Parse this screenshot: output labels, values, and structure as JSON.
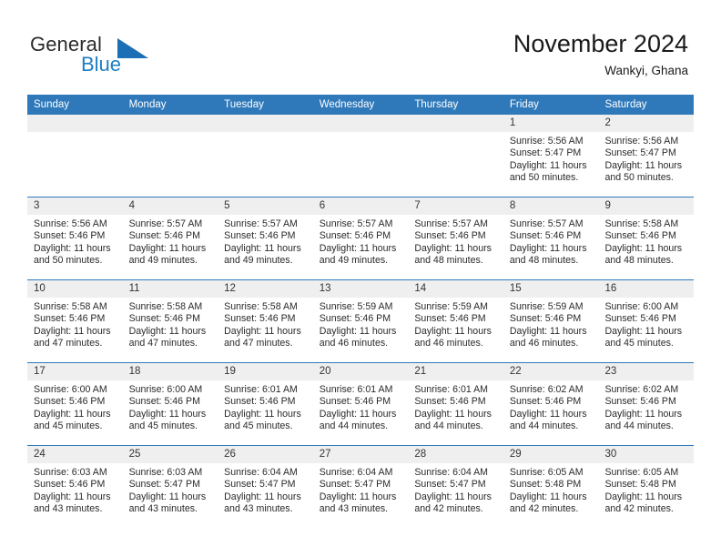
{
  "brand": {
    "word1": "General",
    "word2": "Blue",
    "logo_icon": "triangle-logo-icon"
  },
  "header": {
    "title": "November 2024",
    "location": "Wankyi, Ghana"
  },
  "calendar": {
    "weekday_headers": [
      "Sunday",
      "Monday",
      "Tuesday",
      "Wednesday",
      "Thursday",
      "Friday",
      "Saturday"
    ],
    "colors": {
      "header_bar": "#2f79ba",
      "day_number_strip": "#efefef",
      "row_divider": "#2f79ba",
      "brand_blue": "#1f7ec4"
    },
    "weeks": [
      [
        {
          "day": "",
          "empty": true
        },
        {
          "day": "",
          "empty": true
        },
        {
          "day": "",
          "empty": true
        },
        {
          "day": "",
          "empty": true
        },
        {
          "day": "",
          "empty": true
        },
        {
          "day": "1",
          "sunrise": "Sunrise: 5:56 AM",
          "sunset": "Sunset: 5:47 PM",
          "daylight1": "Daylight: 11 hours",
          "daylight2": "and 50 minutes."
        },
        {
          "day": "2",
          "sunrise": "Sunrise: 5:56 AM",
          "sunset": "Sunset: 5:47 PM",
          "daylight1": "Daylight: 11 hours",
          "daylight2": "and 50 minutes."
        }
      ],
      [
        {
          "day": "3",
          "sunrise": "Sunrise: 5:56 AM",
          "sunset": "Sunset: 5:46 PM",
          "daylight1": "Daylight: 11 hours",
          "daylight2": "and 50 minutes."
        },
        {
          "day": "4",
          "sunrise": "Sunrise: 5:57 AM",
          "sunset": "Sunset: 5:46 PM",
          "daylight1": "Daylight: 11 hours",
          "daylight2": "and 49 minutes."
        },
        {
          "day": "5",
          "sunrise": "Sunrise: 5:57 AM",
          "sunset": "Sunset: 5:46 PM",
          "daylight1": "Daylight: 11 hours",
          "daylight2": "and 49 minutes."
        },
        {
          "day": "6",
          "sunrise": "Sunrise: 5:57 AM",
          "sunset": "Sunset: 5:46 PM",
          "daylight1": "Daylight: 11 hours",
          "daylight2": "and 49 minutes."
        },
        {
          "day": "7",
          "sunrise": "Sunrise: 5:57 AM",
          "sunset": "Sunset: 5:46 PM",
          "daylight1": "Daylight: 11 hours",
          "daylight2": "and 48 minutes."
        },
        {
          "day": "8",
          "sunrise": "Sunrise: 5:57 AM",
          "sunset": "Sunset: 5:46 PM",
          "daylight1": "Daylight: 11 hours",
          "daylight2": "and 48 minutes."
        },
        {
          "day": "9",
          "sunrise": "Sunrise: 5:58 AM",
          "sunset": "Sunset: 5:46 PM",
          "daylight1": "Daylight: 11 hours",
          "daylight2": "and 48 minutes."
        }
      ],
      [
        {
          "day": "10",
          "sunrise": "Sunrise: 5:58 AM",
          "sunset": "Sunset: 5:46 PM",
          "daylight1": "Daylight: 11 hours",
          "daylight2": "and 47 minutes."
        },
        {
          "day": "11",
          "sunrise": "Sunrise: 5:58 AM",
          "sunset": "Sunset: 5:46 PM",
          "daylight1": "Daylight: 11 hours",
          "daylight2": "and 47 minutes."
        },
        {
          "day": "12",
          "sunrise": "Sunrise: 5:58 AM",
          "sunset": "Sunset: 5:46 PM",
          "daylight1": "Daylight: 11 hours",
          "daylight2": "and 47 minutes."
        },
        {
          "day": "13",
          "sunrise": "Sunrise: 5:59 AM",
          "sunset": "Sunset: 5:46 PM",
          "daylight1": "Daylight: 11 hours",
          "daylight2": "and 46 minutes."
        },
        {
          "day": "14",
          "sunrise": "Sunrise: 5:59 AM",
          "sunset": "Sunset: 5:46 PM",
          "daylight1": "Daylight: 11 hours",
          "daylight2": "and 46 minutes."
        },
        {
          "day": "15",
          "sunrise": "Sunrise: 5:59 AM",
          "sunset": "Sunset: 5:46 PM",
          "daylight1": "Daylight: 11 hours",
          "daylight2": "and 46 minutes."
        },
        {
          "day": "16",
          "sunrise": "Sunrise: 6:00 AM",
          "sunset": "Sunset: 5:46 PM",
          "daylight1": "Daylight: 11 hours",
          "daylight2": "and 45 minutes."
        }
      ],
      [
        {
          "day": "17",
          "sunrise": "Sunrise: 6:00 AM",
          "sunset": "Sunset: 5:46 PM",
          "daylight1": "Daylight: 11 hours",
          "daylight2": "and 45 minutes."
        },
        {
          "day": "18",
          "sunrise": "Sunrise: 6:00 AM",
          "sunset": "Sunset: 5:46 PM",
          "daylight1": "Daylight: 11 hours",
          "daylight2": "and 45 minutes."
        },
        {
          "day": "19",
          "sunrise": "Sunrise: 6:01 AM",
          "sunset": "Sunset: 5:46 PM",
          "daylight1": "Daylight: 11 hours",
          "daylight2": "and 45 minutes."
        },
        {
          "day": "20",
          "sunrise": "Sunrise: 6:01 AM",
          "sunset": "Sunset: 5:46 PM",
          "daylight1": "Daylight: 11 hours",
          "daylight2": "and 44 minutes."
        },
        {
          "day": "21",
          "sunrise": "Sunrise: 6:01 AM",
          "sunset": "Sunset: 5:46 PM",
          "daylight1": "Daylight: 11 hours",
          "daylight2": "and 44 minutes."
        },
        {
          "day": "22",
          "sunrise": "Sunrise: 6:02 AM",
          "sunset": "Sunset: 5:46 PM",
          "daylight1": "Daylight: 11 hours",
          "daylight2": "and 44 minutes."
        },
        {
          "day": "23",
          "sunrise": "Sunrise: 6:02 AM",
          "sunset": "Sunset: 5:46 PM",
          "daylight1": "Daylight: 11 hours",
          "daylight2": "and 44 minutes."
        }
      ],
      [
        {
          "day": "24",
          "sunrise": "Sunrise: 6:03 AM",
          "sunset": "Sunset: 5:46 PM",
          "daylight1": "Daylight: 11 hours",
          "daylight2": "and 43 minutes."
        },
        {
          "day": "25",
          "sunrise": "Sunrise: 6:03 AM",
          "sunset": "Sunset: 5:47 PM",
          "daylight1": "Daylight: 11 hours",
          "daylight2": "and 43 minutes."
        },
        {
          "day": "26",
          "sunrise": "Sunrise: 6:04 AM",
          "sunset": "Sunset: 5:47 PM",
          "daylight1": "Daylight: 11 hours",
          "daylight2": "and 43 minutes."
        },
        {
          "day": "27",
          "sunrise": "Sunrise: 6:04 AM",
          "sunset": "Sunset: 5:47 PM",
          "daylight1": "Daylight: 11 hours",
          "daylight2": "and 43 minutes."
        },
        {
          "day": "28",
          "sunrise": "Sunrise: 6:04 AM",
          "sunset": "Sunset: 5:47 PM",
          "daylight1": "Daylight: 11 hours",
          "daylight2": "and 42 minutes."
        },
        {
          "day": "29",
          "sunrise": "Sunrise: 6:05 AM",
          "sunset": "Sunset: 5:48 PM",
          "daylight1": "Daylight: 11 hours",
          "daylight2": "and 42 minutes."
        },
        {
          "day": "30",
          "sunrise": "Sunrise: 6:05 AM",
          "sunset": "Sunset: 5:48 PM",
          "daylight1": "Daylight: 11 hours",
          "daylight2": "and 42 minutes."
        }
      ]
    ]
  }
}
